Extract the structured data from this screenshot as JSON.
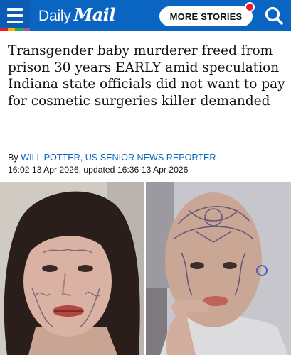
{
  "header": {
    "logo": {
      "daily": "Daily",
      "mail": "Mail"
    },
    "more_stories_label": "MORE STORIES",
    "colors": {
      "bar": "#0a65c2",
      "notification": "#e41e2f"
    },
    "icons": [
      "menu-icon",
      "search-icon"
    ]
  },
  "article": {
    "headline": "Transgender baby murderer freed from prison 30 years EARLY amid speculation Indiana state officials did not want to pay for cosmetic surgeries killer demanded",
    "byline_prefix": "By ",
    "author": "WILL POTTER, US SENIOR NEWS REPORTER",
    "timestamp": "16:02 13 Apr 2026, updated 16:36 13 Apr 2026"
  }
}
